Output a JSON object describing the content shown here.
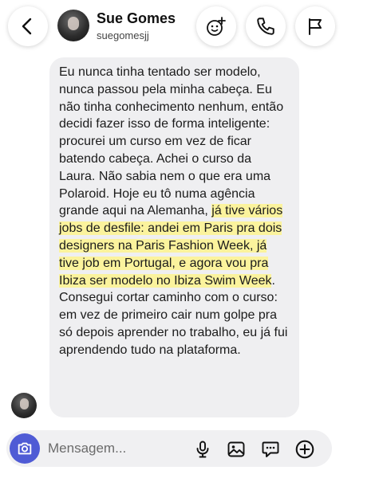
{
  "header": {
    "name": "Sue Gomes",
    "username": "suegomesjj",
    "icons": [
      "back-icon",
      "effects-icon",
      "phone-icon",
      "flag-icon"
    ]
  },
  "message": {
    "part1": "Eu nunca tinha tentado ser modelo, nunca passou pela minha cabeça. Eu não tinha conhecimento nenhum, então decidi fazer isso de forma inteligente: procurei um curso em vez de ficar batendo cabeça. Achei o curso da Laura. Não sabia nem o que era uma Polaroid. Hoje eu tô numa agência grande aqui na Alemanha, ",
    "highlight": "já tive vários jobs de desfile: andei em Paris pra dois designers na Paris Fashion Week, já tive job em Portugal, e agora vou pra Ibiza ser modelo no Ibiza Swim Week",
    "part2": ".",
    "part3": "Consegui cortar caminho com o curso: em vez de primeiro cair num golpe pra só depois aprender no trabalho, eu já fui aprendendo tudo na plataforma.",
    "highlight_color": "#fbf39d"
  },
  "composer": {
    "placeholder": "Mensagem...",
    "icons": [
      "camera-icon",
      "microphone-icon",
      "gallery-icon",
      "sticker-icon",
      "plus-icon"
    ],
    "camera_color": "#4f5bd5"
  }
}
